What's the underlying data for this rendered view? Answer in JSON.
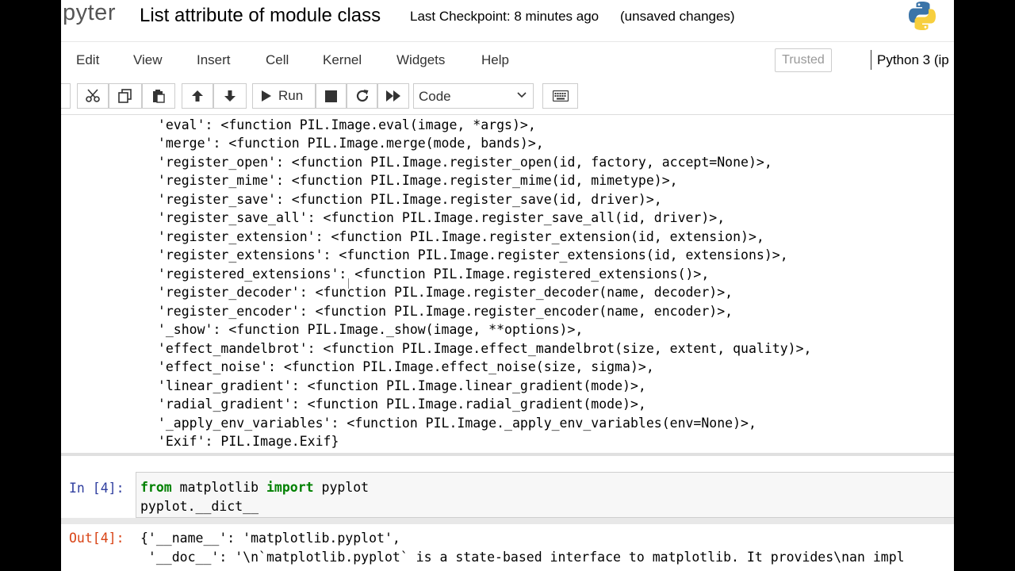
{
  "header": {
    "logo_text": "pyter",
    "notebook_title": "List attribute of module class",
    "checkpoint": "Last Checkpoint: 8 minutes ago",
    "unsaved": "(unsaved changes)",
    "logo_icon": "python-logo-icon"
  },
  "menubar": {
    "items": [
      "Edit",
      "View",
      "Insert",
      "Cell",
      "Kernel",
      "Widgets",
      "Help"
    ],
    "trusted": "Trusted",
    "kernel": "Python 3 (ip"
  },
  "toolbar": {
    "run_label": "Run",
    "cell_type": "Code",
    "icons": [
      "save-icon",
      "cut-icon",
      "copy-icon",
      "paste-icon",
      "move-up-icon",
      "move-down-icon",
      "run-icon",
      "stop-icon",
      "restart-icon",
      "fast-forward-icon",
      "chevron-down-icon",
      "keyboard-icon"
    ]
  },
  "output_lines": [
    " 'eval': <function PIL.Image.eval(image, *args)>,",
    " 'merge': <function PIL.Image.merge(mode, bands)>,",
    " 'register_open': <function PIL.Image.register_open(id, factory, accept=None)>,",
    " 'register_mime': <function PIL.Image.register_mime(id, mimetype)>,",
    " 'register_save': <function PIL.Image.register_save(id, driver)>,",
    " 'register_save_all': <function PIL.Image.register_save_all(id, driver)>,",
    " 'register_extension': <function PIL.Image.register_extension(id, extension)>,",
    " 'register_extensions': <function PIL.Image.register_extensions(id, extensions)>,",
    " 'registered_extensions': <function PIL.Image.registered_extensions()>,",
    " 'register_decoder': <function PIL.Image.register_decoder(name, decoder)>,",
    " 'register_encoder': <function PIL.Image.register_encoder(name, encoder)>,",
    " '_show': <function PIL.Image._show(image, **options)>,",
    " 'effect_mandelbrot': <function PIL.Image.effect_mandelbrot(size, extent, quality)>,",
    " 'effect_noise': <function PIL.Image.effect_noise(size, sigma)>,",
    " 'linear_gradient': <function PIL.Image.linear_gradient(mode)>,",
    " 'radial_gradient': <function PIL.Image.radial_gradient(mode)>,",
    " '_apply_env_variables': <function PIL.Image._apply_env_variables(env=None)>,",
    " 'Exif': PIL.Image.Exif}"
  ],
  "input_cell": {
    "prompt": "In [4]:",
    "kw_from": "from",
    "mod": " matplotlib ",
    "kw_import": "import",
    "name": " pyplot",
    "line2": "pyplot.__dict__"
  },
  "output_cell": {
    "prompt": "Out[4]:",
    "line1": "{'__name__': 'matplotlib.pyplot',",
    "line2": " '__doc__': '\\n`matplotlib.pyplot` is a state-based interface to matplotlib. It provides\\nan impl"
  },
  "colors": {
    "in_prompt": "#303f9f",
    "out_prompt": "#d84315",
    "keyword": "#008000"
  }
}
